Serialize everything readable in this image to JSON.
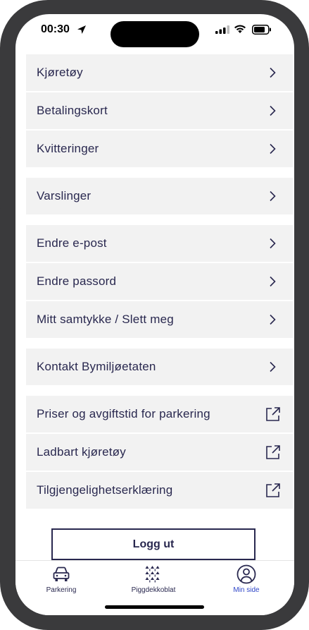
{
  "status_bar": {
    "time": "00:30",
    "icons": [
      "location-arrow-icon",
      "cellular-signal-icon",
      "wifi-icon",
      "battery-icon"
    ]
  },
  "menu": {
    "groups": [
      {
        "items": [
          {
            "label": "Kjøretøy",
            "icon": "chevron-right-icon"
          },
          {
            "label": "Betalingskort",
            "icon": "chevron-right-icon"
          },
          {
            "label": "Kvitteringer",
            "icon": "chevron-right-icon"
          }
        ]
      },
      {
        "items": [
          {
            "label": "Varslinger",
            "icon": "chevron-right-icon"
          }
        ]
      },
      {
        "items": [
          {
            "label": "Endre e-post",
            "icon": "chevron-right-icon"
          },
          {
            "label": "Endre passord",
            "icon": "chevron-right-icon"
          },
          {
            "label": "Mitt samtykke / Slett meg",
            "icon": "chevron-right-icon"
          }
        ]
      },
      {
        "items": [
          {
            "label": "Kontakt Bymiljøetaten",
            "icon": "chevron-right-icon"
          }
        ]
      },
      {
        "items": [
          {
            "label": "Priser og avgiftstid for parkering",
            "icon": "external-link-icon"
          },
          {
            "label": "Ladbart kjøretøy",
            "icon": "external-link-icon"
          },
          {
            "label": "Tilgjengelighetserklæring",
            "icon": "external-link-icon"
          }
        ]
      }
    ]
  },
  "logout": {
    "label": "Logg ut"
  },
  "tabbar": {
    "tabs": [
      {
        "label": "Parkering",
        "icon": "car-icon",
        "active": false
      },
      {
        "label": "Piggdekkoblat",
        "icon": "studded-tire-icon",
        "active": false
      },
      {
        "label": "Min side",
        "icon": "user-profile-icon",
        "active": true
      }
    ]
  },
  "colors": {
    "text": "#29284f",
    "row_background": "#f2f2f2",
    "active_tab": "#2f46c8",
    "device_frame": "#3a3a3c"
  }
}
